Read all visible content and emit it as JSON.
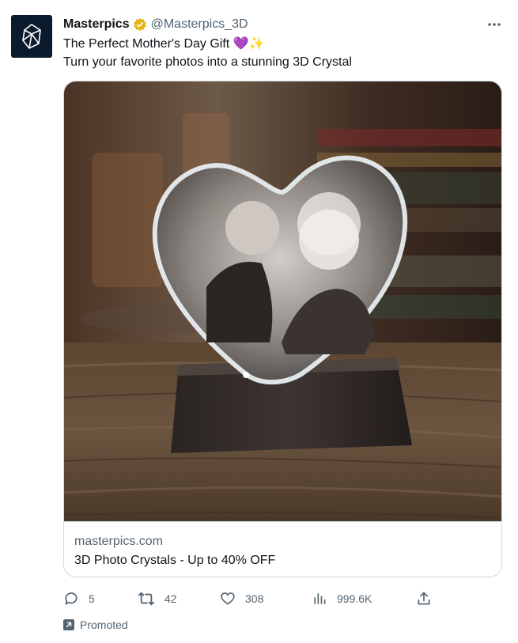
{
  "author": {
    "display_name": "Masterpics",
    "handle": "@Masterpics_3D",
    "verified_badge_color": "#e2b719",
    "avatar_color": "#0c1a2e"
  },
  "tweet": {
    "line1": "The Perfect Mother's Day Gift 💜✨",
    "line2": "Turn your favorite photos into a stunning 3D Crystal"
  },
  "card": {
    "domain": "masterpics.com",
    "title": "3D Photo Crystals - Up to 40% OFF"
  },
  "actions": {
    "replies": "5",
    "retweets": "42",
    "likes": "308",
    "views": "999.6K"
  },
  "promoted_label": "Promoted",
  "colors": {
    "text": "#0f1419",
    "secondary": "#536471",
    "border": "#cfd9de"
  },
  "icons": [
    "verified-badge-icon",
    "more-icon",
    "reply-icon",
    "retweet-icon",
    "like-icon",
    "views-icon",
    "share-icon",
    "promoted-icon"
  ]
}
